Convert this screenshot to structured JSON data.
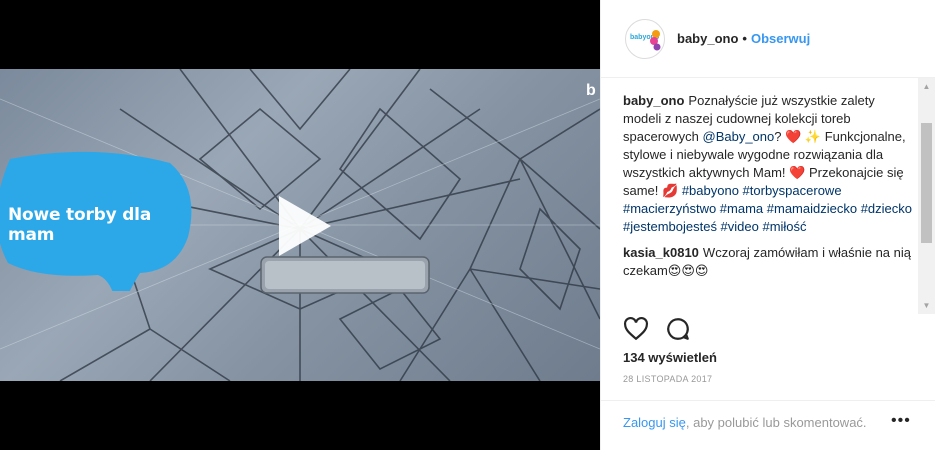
{
  "video": {
    "overlay_text": "Nowe torby dla mam",
    "corner_mark": "b"
  },
  "header": {
    "avatar_text": "babyono",
    "username": "baby_ono",
    "separator": "•",
    "follow_label": "Obserwuj"
  },
  "caption": {
    "username": "baby_ono",
    "text_1": "Poznałyście już wszystkie zalety modeli z naszej cudownej kolekcji toreb spacerowych",
    "mention": "@Baby_ono",
    "text_2": "? ❤️ ✨ Funkcjonalne, stylowe i niebywale wygodne rozwiązania dla wszystkich aktywnych Mam! ❤️  Przekonajcie się same! 💋",
    "hashtags": "#babyono #torbyspacerowe #macierzyństwo #mama #mamaidziecko #dziecko #jestembojesteś #video #miłość"
  },
  "comments": [
    {
      "username": "kasia_k0810",
      "text": "Wczoraj zamówiłam i właśnie na nią czekam😍😍😍"
    }
  ],
  "stats": {
    "views": "134 wyświetleń",
    "date": "28 LISTOPADA 2017"
  },
  "footer": {
    "login_link": "Zaloguj się",
    "login_text": ", aby polubić lub skomentować.",
    "more_label": "•••"
  },
  "colors": {
    "link": "#3897f0",
    "bubble": "#2ca8e8",
    "heart": "#e0244a"
  },
  "icons": {
    "like": "heart-outline-icon",
    "comment": "speech-bubble-icon",
    "play": "play-icon",
    "options": "more-options-icon"
  }
}
